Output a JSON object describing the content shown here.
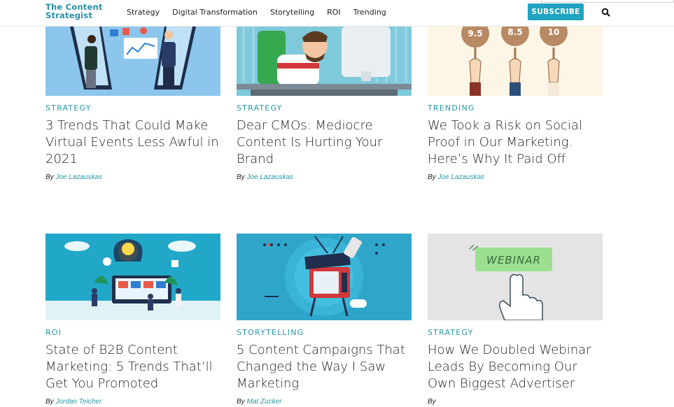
{
  "header": {
    "logo_line1": "The Content",
    "logo_line2": "Strategist",
    "nav": [
      "Strategy",
      "Digital Transformation",
      "Storytelling",
      "ROI",
      "Trending"
    ],
    "subscribe_label": "SUBSCRIBE",
    "search_icon": "search-icon"
  },
  "colors": {
    "accent": "#2896a5",
    "subscribe_bg": "#1fa3c0"
  },
  "cards": [
    {
      "category": "STRATEGY",
      "title": "3 Trends That Could Make Virtual Events Less Awful in 2021",
      "by": "By",
      "author": "Joe Lazauskas"
    },
    {
      "category": "STRATEGY",
      "title": "Dear CMOs: Mediocre Content Is Hurting Your Brand",
      "by": "By",
      "author": "Joe Lazauskas"
    },
    {
      "category": "TRENDING",
      "title": "We Took a Risk on Social Proof in Our Marketing. Here’s Why It Paid Off",
      "by": "By",
      "author": "Joe Lazauskas",
      "image_scores": [
        "9.5",
        "8.5",
        "10"
      ]
    },
    {
      "category": "ROI",
      "title": "State of B2B Content Marketing: 5 Trends That’ll Get You Promoted",
      "by": "By",
      "author": "Jordan Teicher"
    },
    {
      "category": "STORYTELLING",
      "title": "5 Content Campaigns That Changed the Way I Saw Marketing",
      "by": "By",
      "author": "Mat Zucker"
    },
    {
      "category": "STRATEGY",
      "title": "How We Doubled Webinar Leads By Becoming Our Own Biggest Advertiser",
      "by": "By",
      "author": "",
      "image_label": "WEBINAR"
    }
  ]
}
